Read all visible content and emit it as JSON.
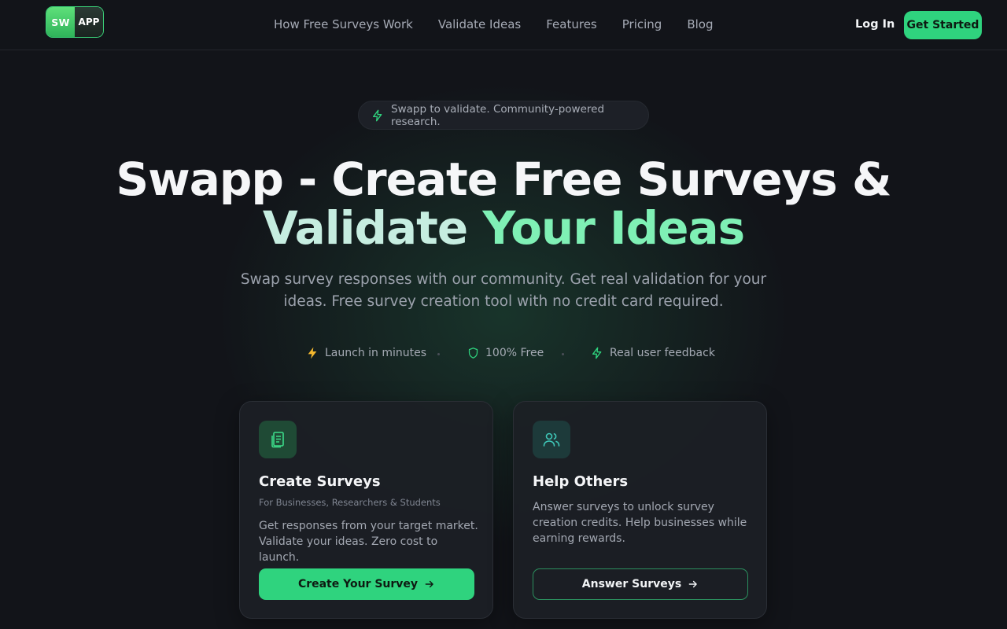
{
  "header": {
    "logo_left": "SW",
    "logo_right": "APP",
    "nav": [
      "How Free Surveys Work",
      "Validate Ideas",
      "Features",
      "Pricing",
      "Blog"
    ],
    "login_label": "Log In",
    "cta_label": "Get Started"
  },
  "hero": {
    "pill_text": "Swapp to validate. Community-powered research.",
    "headline_line1": "Swapp - Create Free Surveys &",
    "headline_line2_a": "Validate ",
    "headline_line2_b": "Your Ideas",
    "subtitle": "Swap survey responses with our community. Get real validation for your ideas. Free survey creation tool with no credit card required.",
    "features": [
      {
        "icon": "lightning-emoji-icon",
        "label": "Launch in minutes"
      },
      {
        "icon": "shield-icon",
        "label": "100% Free"
      },
      {
        "icon": "bolt-icon",
        "label": "Real user feedback"
      }
    ]
  },
  "cards": [
    {
      "icon": "document-icon",
      "title": "Create Surveys",
      "subtitle": "For Businesses, Researchers & Students",
      "description": "Get responses from your target market. Validate your ideas. Zero cost to launch.",
      "button": "Create Your Survey"
    },
    {
      "icon": "users-icon",
      "title": "Help Others",
      "description": "Answer surveys to unlock survey creation credits. Help businesses while earning rewards.",
      "button": "Answer Surveys"
    }
  ],
  "colors": {
    "accent": "#2fd37e",
    "background": "#121419",
    "headline_light_green": "#7ff0b5"
  }
}
